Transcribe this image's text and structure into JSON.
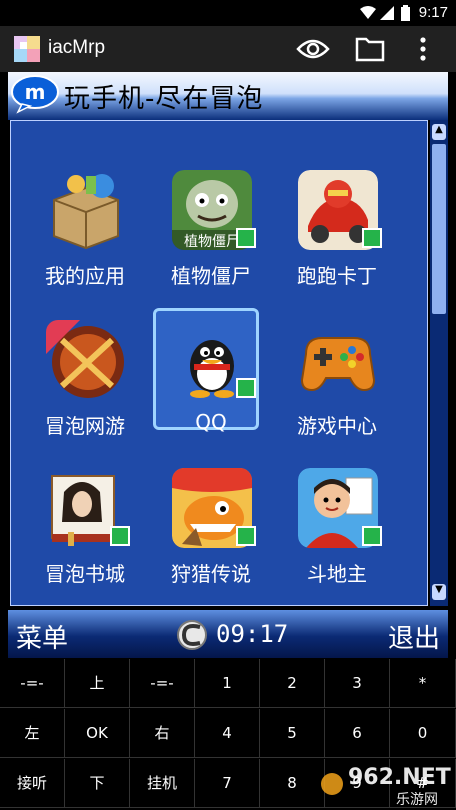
{
  "status": {
    "time": "9:17"
  },
  "appbar": {
    "title": "iacMrp"
  },
  "header": {
    "title": "玩手机-尽在冒泡"
  },
  "apps": [
    {
      "label": "我的应用",
      "icon": "box-icon"
    },
    {
      "label": "植物僵尸",
      "icon": "zombie-game-icon",
      "icon_text": "植物僵尸"
    },
    {
      "label": "跑跑卡丁",
      "icon": "kart-game-icon"
    },
    {
      "label": "冒泡网游",
      "icon": "online-game-icon"
    },
    {
      "label": "QQ",
      "icon": "qq-penguin-icon"
    },
    {
      "label": "游戏中心",
      "icon": "gamepad-icon"
    },
    {
      "label": "冒泡书城",
      "icon": "book-icon"
    },
    {
      "label": "狩猎传说",
      "icon": "dino-game-icon"
    },
    {
      "label": "斗地主",
      "icon": "poker-game-icon"
    }
  ],
  "softbar": {
    "left": "菜单",
    "clock": "09:17",
    "right": "退出"
  },
  "keypad": [
    [
      "-=-",
      "上",
      "-=-",
      "1",
      "2",
      "3",
      "*"
    ],
    [
      "左",
      "OK",
      "右",
      "4",
      "5",
      "6",
      "0"
    ],
    [
      "接听",
      "下",
      "挂机",
      "7",
      "8",
      "9",
      "#"
    ]
  ],
  "watermark": {
    "brand": "962.NET",
    "subtitle": "乐游网"
  },
  "colors": {
    "appbar": "#212121",
    "panel": "#1f4aa8",
    "softbar": "#0b2a74",
    "download_badge": "#25b34a"
  }
}
